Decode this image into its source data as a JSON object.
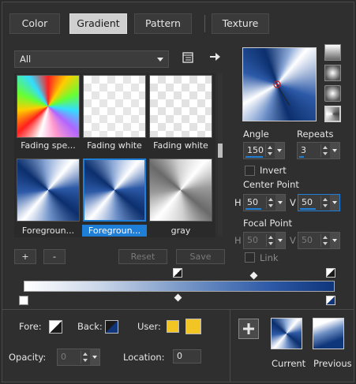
{
  "tabs": [
    "Color",
    "Gradient",
    "Pattern",
    "Texture"
  ],
  "active_tab": "Gradient",
  "category_dropdown": {
    "value": "All"
  },
  "gallery": {
    "items": [
      {
        "label": "Fading spe..."
      },
      {
        "label": "Fading white"
      },
      {
        "label": "Fading white"
      },
      {
        "label": "Foregroun..."
      },
      {
        "label": "Foregroun..."
      },
      {
        "label": "gray"
      }
    ],
    "selected_index": 4
  },
  "buttons": {
    "add": "+",
    "remove": "-",
    "reset": "Reset",
    "save": "Save"
  },
  "angle": {
    "label": "Angle",
    "value": "150"
  },
  "repeats": {
    "label": "Repeats",
    "value": "3"
  },
  "invert": {
    "label": "Invert"
  },
  "center_point": {
    "label": "Center Point",
    "h_label": "H",
    "h_value": "50",
    "v_label": "V",
    "v_value": "50"
  },
  "focal_point": {
    "label": "Focal Point",
    "h_label": "H",
    "h_value": "50",
    "v_label": "V",
    "v_value": "50"
  },
  "link": {
    "label": "Link"
  },
  "fore": {
    "label": "Fore:"
  },
  "back": {
    "label": "Back:"
  },
  "user": {
    "label": "User:"
  },
  "opacity": {
    "label": "Opacity:",
    "value": "0"
  },
  "location": {
    "label": "Location:",
    "value": "0"
  },
  "current": {
    "label": "Current"
  },
  "previous": {
    "label": "Previous"
  },
  "colors": {
    "accent": "#1f7fd6",
    "user_color": "#f3c524",
    "gradient_dark": "#0f357a"
  }
}
